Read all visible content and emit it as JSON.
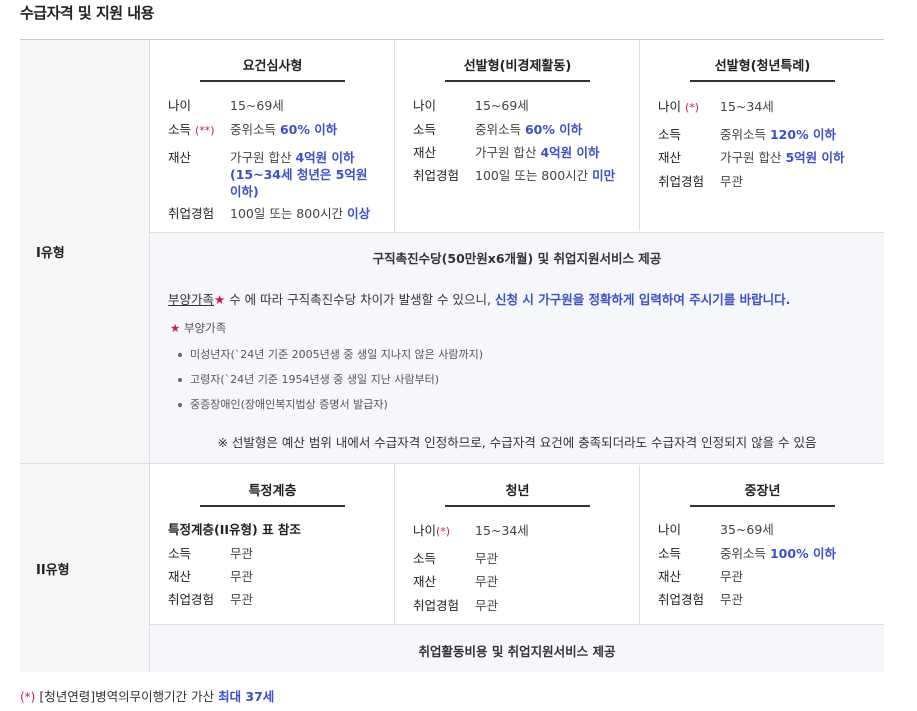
{
  "section_title": "수급자격 및 지원 내용",
  "type1": {
    "label": "I유형",
    "columns": [
      {
        "header": "요건심사형",
        "rows": [
          {
            "key": "나이",
            "mark": "",
            "value": "15~69세",
            "hi": "",
            "value2": ""
          },
          {
            "key": "소득",
            "mark": "(**)",
            "value": "중위소득 ",
            "hi": "60% 이하",
            "value2": ""
          },
          {
            "key": "재산",
            "mark": "",
            "value": "가구원 합산 ",
            "hi": "4억원 이하 (15~34세 청년은 5억원 이하)",
            "value2": ""
          },
          {
            "key": "취업경험",
            "mark": "",
            "value": "100일 또는 800시간 ",
            "hi": "이상",
            "value2": ""
          }
        ]
      },
      {
        "header": "선발형(비경제활동)",
        "rows": [
          {
            "key": "나이",
            "mark": "",
            "value": "15~69세",
            "hi": "",
            "value2": ""
          },
          {
            "key": "소득",
            "mark": "",
            "value": "중위소득 ",
            "hi": "60% 이하",
            "value2": ""
          },
          {
            "key": "재산",
            "mark": "",
            "value": "가구원 합산 ",
            "hi": "4억원 이하",
            "value2": ""
          },
          {
            "key": "취업경험",
            "mark": "",
            "value": "100일 또는 800시간 ",
            "hi": "미만",
            "value2": ""
          }
        ]
      },
      {
        "header": "선발형(청년특례)",
        "rows": [
          {
            "key": "나이",
            "mark": "(*)",
            "value": "15~34세",
            "hi": "",
            "value2": ""
          },
          {
            "key": "소득",
            "mark": "",
            "value": "중위소득 ",
            "hi": "120% 이하",
            "value2": ""
          },
          {
            "key": "재산",
            "mark": "",
            "value": "가구원 합산 ",
            "hi": "5억원 이하",
            "value2": ""
          },
          {
            "key": "취업경험",
            "mark": "",
            "value": "무관",
            "hi": "",
            "value2": ""
          }
        ]
      }
    ],
    "support": "구직촉진수당(50만원x6개월) 및 취업지원서비스 제공",
    "note_underlined": "부양가족",
    "note_star": "★",
    "note_text": " 수 에 따라 구직촉진수당 차이가 발생할 수 있으니, ",
    "note_highlight": "신청 시 가구원을 정확하게 입력하여 주시기를 바랍니다.",
    "dependents_title_star": "★",
    "dependents_title": " 부양가족",
    "dependents": [
      "미성년자(`24년 기준 2005년생 중 생일 지나지 않은 사람까지)",
      "고령자(`24년 기준 1954년생 중 생일 지난 사람부터)",
      "중증장애인(장애인복지법상 증명서 발급자)"
    ],
    "notice": "※ 선발형은 예산 범위 내에서 수급자격 인정하므로, 수급자격 요건에 충족되더라도 수급자격 인정되지 않을 수 있음"
  },
  "type2": {
    "label": "II유형",
    "columns": [
      {
        "header": "특정계층",
        "lead": "특정계층(II유형) 표 참조",
        "rows": [
          {
            "key": "소득",
            "mark": "",
            "value": "무관",
            "hi": ""
          },
          {
            "key": "재산",
            "mark": "",
            "value": "무관",
            "hi": ""
          },
          {
            "key": "취업경험",
            "mark": "",
            "value": "무관",
            "hi": ""
          }
        ]
      },
      {
        "header": "청년",
        "lead": "",
        "rows": [
          {
            "key": "나이",
            "mark": "(*)",
            "value": "15~34세",
            "hi": ""
          },
          {
            "key": "소득",
            "mark": "",
            "value": "무관",
            "hi": ""
          },
          {
            "key": "재산",
            "mark": "",
            "value": "무관",
            "hi": ""
          },
          {
            "key": "취업경험",
            "mark": "",
            "value": "무관",
            "hi": ""
          }
        ]
      },
      {
        "header": "중장년",
        "lead": "",
        "rows": [
          {
            "key": "나이",
            "mark": "",
            "value": "35~69세",
            "hi": ""
          },
          {
            "key": "소득",
            "mark": "",
            "value": "중위소득 ",
            "hi": "100% 이하"
          },
          {
            "key": "재산",
            "mark": "",
            "value": "무관",
            "hi": ""
          },
          {
            "key": "취업경험",
            "mark": "",
            "value": "무관",
            "hi": ""
          }
        ]
      }
    ],
    "support": "취업활동비용 및 취업지원서비스 제공"
  },
  "footnote": {
    "mark": "(*)",
    "text": " [청년연령]병역의무이행기간 가산 ",
    "highlight": "최대 37세"
  },
  "colors": {
    "highlight": "#3b50c8",
    "mark": "#d0175c",
    "panel_bg": "#f5f7fb",
    "head_bg": "#f6f6f6"
  }
}
